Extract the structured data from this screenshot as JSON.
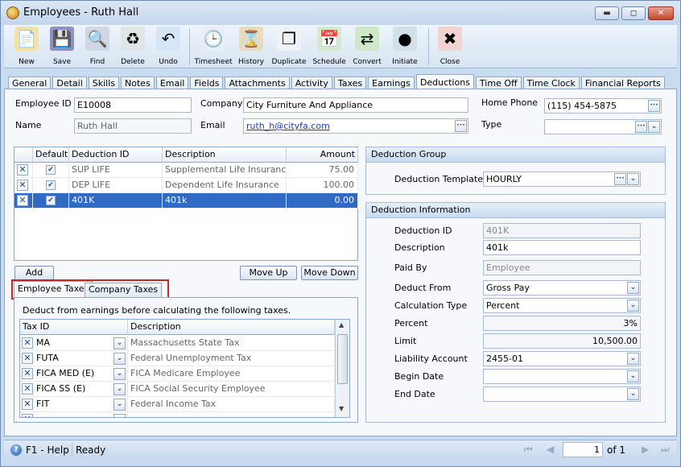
{
  "window": {
    "title": "Employees - Ruth Hall",
    "minimize": "▬",
    "maximize": "◻",
    "close": "✕"
  },
  "toolbar": [
    {
      "label": "New",
      "icon": "new-document-icon",
      "glyph": "📄",
      "color": "#f3e2a8"
    },
    {
      "label": "Save",
      "icon": "floppy-disk-icon",
      "glyph": "💾",
      "color": "#8f8fc8"
    },
    {
      "label": "Find",
      "icon": "binoculars-icon",
      "glyph": "🔍",
      "color": "#cfd8e4"
    },
    {
      "label": "Delete",
      "icon": "recycle-bin-icon",
      "glyph": "♻",
      "color": "#dfe6e6"
    },
    {
      "label": "Undo",
      "icon": "undo-arrow-icon",
      "glyph": "↶",
      "color": "#d7e6f7"
    },
    {
      "sep": true
    },
    {
      "label": "Timesheet",
      "icon": "timesheet-clock-icon",
      "glyph": "🕒",
      "color": "#e8eef5"
    },
    {
      "label": "History",
      "icon": "history-hourglass-icon",
      "glyph": "⌛",
      "color": "#e8dcc0"
    },
    {
      "label": "Duplicate",
      "icon": "duplicate-icon",
      "glyph": "❐",
      "color": "#eef1f5"
    },
    {
      "label": "Schedule",
      "icon": "schedule-icon",
      "glyph": "📅",
      "color": "#d5e8d0"
    },
    {
      "label": "Convert",
      "icon": "convert-arrows-icon",
      "glyph": "⇄",
      "color": "#cfe9c8"
    },
    {
      "label": "Initiate",
      "icon": "traffic-light-icon",
      "glyph": "●",
      "color": "#d3e0ea"
    },
    {
      "sep": true
    },
    {
      "label": "Close",
      "icon": "close-window-icon",
      "glyph": "✖",
      "color": "#f2d4cf"
    }
  ],
  "tabs": [
    "General",
    "Detail",
    "Skills",
    "Notes",
    "Email",
    "Fields",
    "Attachments",
    "Activity",
    "Taxes",
    "Earnings",
    "Deductions",
    "Time Off",
    "Time Clock",
    "Financial Reports"
  ],
  "active_tab": "Deductions",
  "header": {
    "employee_id_label": "Employee ID",
    "employee_id": "E10008",
    "name_label": "Name",
    "name": "Ruth Hall",
    "company_label": "Company",
    "company": "City Furniture And Appliance",
    "email_label": "Email",
    "email": "ruth_h@cityfa.com",
    "home_phone_label": "Home Phone",
    "home_phone": "(115) 454-5875",
    "type_label": "Type",
    "type": ""
  },
  "deductions": {
    "columns": [
      "",
      "Default",
      "Deduction ID",
      "Description",
      "Amount"
    ],
    "rows": [
      {
        "default": true,
        "id": "SUP LIFE",
        "description": "Supplemental Life Insurance",
        "amount": "75.00"
      },
      {
        "default": true,
        "id": "DEP LIFE",
        "description": "Dependent Life Insurance",
        "amount": "100.00"
      },
      {
        "default": true,
        "id": "401K",
        "description": "401k",
        "amount": "0.00",
        "selected": true
      }
    ],
    "add": "Add",
    "move_up": "Move Up",
    "move_down": "Move Down"
  },
  "tax_tabs": {
    "employee": "Employee Taxes",
    "company": "Company Taxes",
    "active": "Employee Taxes",
    "highlight_color": "#c0282d"
  },
  "taxes": {
    "note": "Deduct from earnings before calculating the following taxes.",
    "columns": [
      "Tax ID",
      "Description"
    ],
    "rows": [
      {
        "id": "MA",
        "description": "Massachusetts State Tax"
      },
      {
        "id": "FUTA",
        "description": "Federal Unemployment Tax"
      },
      {
        "id": "FICA MED (E)",
        "description": "FICA Medicare Employee"
      },
      {
        "id": "FICA SS (E)",
        "description": "FICA Social Security Employee"
      },
      {
        "id": "FIT",
        "description": "Federal Income Tax"
      }
    ]
  },
  "deduction_group": {
    "title": "Deduction Group",
    "template_label": "Deduction Template",
    "template": "HOURLY"
  },
  "deduction_info": {
    "title": "Deduction Information",
    "fields": [
      {
        "label": "Deduction ID",
        "value": "401K",
        "kind": "dis"
      },
      {
        "label": "Description",
        "value": "401k",
        "kind": "text"
      },
      {
        "label": "Paid By",
        "value": "Employee",
        "kind": "dis"
      },
      {
        "label": "Deduct From",
        "value": "Gross Pay",
        "kind": "combo"
      },
      {
        "label": "Calculation Type",
        "value": "Percent",
        "kind": "combo"
      },
      {
        "label": "Percent",
        "value": "3%",
        "kind": "num"
      },
      {
        "label": "Limit",
        "value": "10,500.00",
        "kind": "num"
      },
      {
        "label": "Liability Account",
        "value": "2455-01",
        "kind": "combo"
      },
      {
        "label": "Begin Date",
        "value": "",
        "kind": "combo"
      },
      {
        "label": "End Date",
        "value": "",
        "kind": "combo"
      }
    ]
  },
  "status": {
    "help": "F1 - Help",
    "state": "Ready",
    "page": "1",
    "of": "of 1"
  }
}
